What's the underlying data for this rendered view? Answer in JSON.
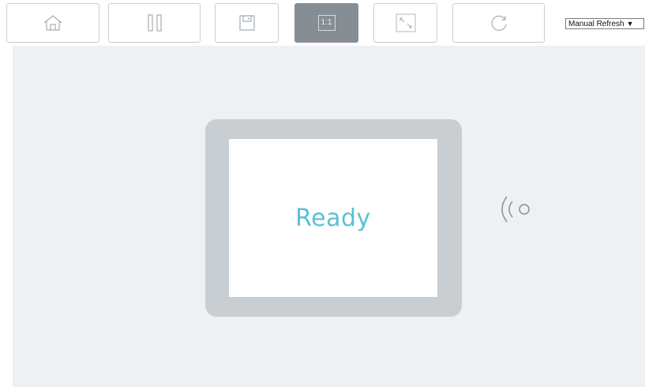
{
  "toolbar": {
    "buttons": [
      {
        "name": "home-button",
        "icon": "home-icon"
      },
      {
        "name": "pause-button",
        "icon": "pause-icon"
      },
      {
        "name": "save-button",
        "icon": "save-icon"
      },
      {
        "name": "actual-size-button",
        "icon": "actual-size-icon",
        "label": "1:1",
        "active": true
      },
      {
        "name": "fit-screen-button",
        "icon": "expand-icon"
      },
      {
        "name": "refresh-button",
        "icon": "refresh-icon"
      }
    ],
    "refresh_mode": {
      "selected": "Manual Refresh"
    }
  },
  "device": {
    "status": "Ready",
    "signal_icon": "contactless-signal-icon"
  },
  "colors": {
    "status_text": "#5bc0d8",
    "frame": "#c8ced2",
    "stage_background": "#eef0f2",
    "active_button": "#868d93"
  }
}
